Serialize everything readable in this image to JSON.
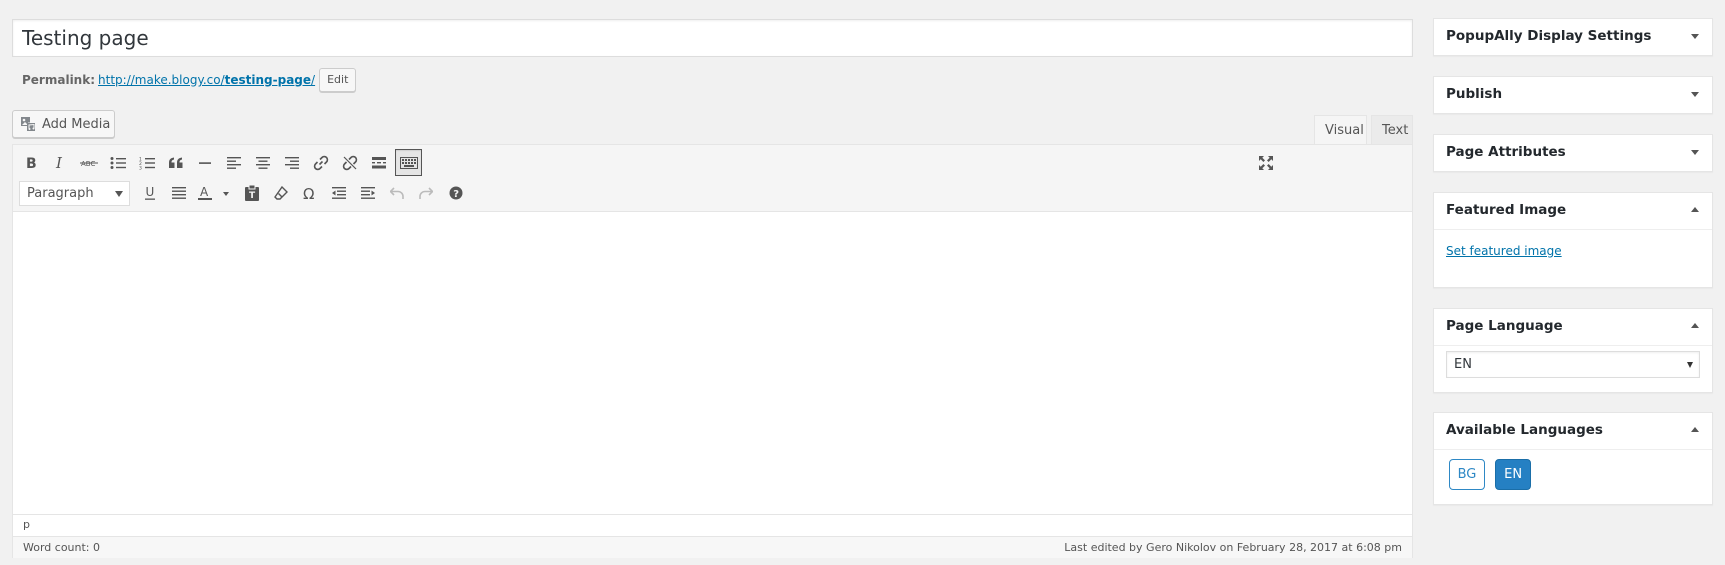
{
  "editor": {
    "title_value": "Testing page",
    "permalink_label": "Permalink:",
    "permalink_base": "http://make.blogy.co/",
    "permalink_slug": "testing-page",
    "permalink_trailing": "/",
    "edit_button": "Edit",
    "add_media_label": "Add Media",
    "tabs": {
      "visual": "Visual",
      "text": "Text"
    },
    "format_select": "Paragraph",
    "path": "p",
    "word_count": "Word count: 0",
    "last_edited": "Last edited by Gero Nikolov on February 28, 2017 at 6:08 pm",
    "toolbar_row1": [
      "bold-icon",
      "italic-icon",
      "strikethrough-icon",
      "bullet-list-icon",
      "numbered-list-icon",
      "blockquote-icon",
      "horizontal-line-icon",
      "align-left-icon",
      "align-center-icon",
      "align-right-icon",
      "link-icon",
      "unlink-icon",
      "read-more-icon",
      "toolbar-toggle-icon"
    ],
    "toolbar_row2": [
      "underline-icon",
      "justify-icon",
      "text-color-icon",
      "paste-text-icon",
      "clear-formatting-icon",
      "special-character-icon",
      "outdent-icon",
      "indent-icon",
      "undo-icon",
      "redo-icon",
      "help-icon"
    ]
  },
  "sidebar": {
    "popupally": {
      "title": "PopupAlly Display Settings",
      "state": "collapsed"
    },
    "publish": {
      "title": "Publish",
      "state": "collapsed"
    },
    "page_attributes": {
      "title": "Page Attributes",
      "state": "collapsed"
    },
    "featured_image": {
      "title": "Featured Image",
      "state": "expanded",
      "link": "Set featured image"
    },
    "page_language": {
      "title": "Page Language",
      "state": "expanded",
      "selected": "EN"
    },
    "available_languages": {
      "title": "Available Languages",
      "state": "expanded",
      "buttons": [
        "BG",
        "EN"
      ],
      "active": "EN"
    }
  },
  "colors": {
    "link": "#0073aa",
    "accent": "#2580c3",
    "background": "#f1f1f1"
  }
}
